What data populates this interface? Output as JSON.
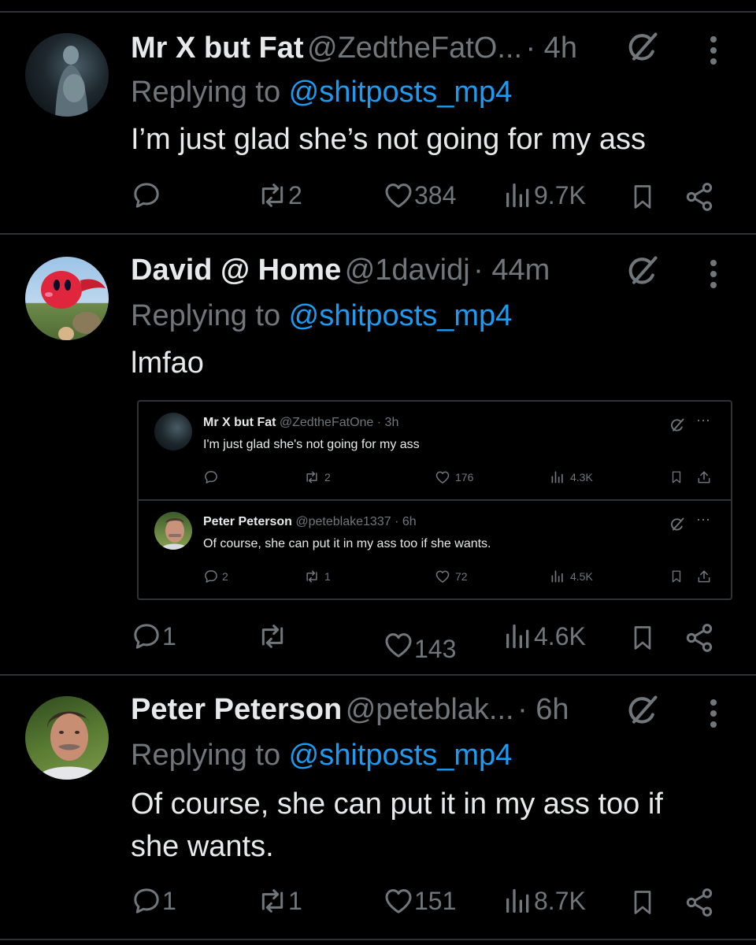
{
  "tweets": [
    {
      "name": "Mr X but Fat",
      "handle": "@ZedtheFatO...",
      "time": "· 4h",
      "replying_prefix": "Replying to ",
      "replying_to": "@shitposts_mp4",
      "text": "I’m just glad she’s not going for my ass",
      "replies": "",
      "reposts": "2",
      "likes": "384",
      "views": "9.7K"
    },
    {
      "name": "David @ Home",
      "handle": "@1davidj",
      "time": "· 44m",
      "replying_prefix": "Replying to ",
      "replying_to": "@shitposts_mp4",
      "text": "lmfao",
      "replies": "1",
      "reposts": "",
      "likes": "143",
      "views": "4.6K"
    },
    {
      "name": "Peter Peterson",
      "handle": "@peteblak...",
      "time": "· 6h",
      "replying_prefix": "Replying to ",
      "replying_to": "@shitposts_mp4",
      "text": "Of course, she can put it in my ass too if she wants.",
      "replies": "1",
      "reposts": "1",
      "likes": "151",
      "views": "8.7K"
    }
  ],
  "quoted": [
    {
      "name": "Mr X but Fat",
      "handle": "@ZedtheFatOne",
      "time": "· 3h",
      "text": "I'm just glad she's not going for my ass",
      "replies": "",
      "reposts": "2",
      "likes": "176",
      "views": "4.3K"
    },
    {
      "name": "Peter Peterson",
      "handle": "@peteblake1337",
      "time": "· 6h",
      "text": "Of course, she can put it in my ass too if she wants.",
      "replies": "2",
      "reposts": "1",
      "likes": "72",
      "views": "4.5K"
    }
  ],
  "colors": {
    "background": "#000000",
    "text": "#e7e9ea",
    "muted": "#71767b",
    "link": "#1d9bf0",
    "divider": "#2f3336"
  },
  "icons": [
    "reply-icon",
    "repost-icon",
    "like-icon",
    "views-icon",
    "bookmark-icon",
    "share-icon",
    "grok-icon",
    "more-icon"
  ]
}
